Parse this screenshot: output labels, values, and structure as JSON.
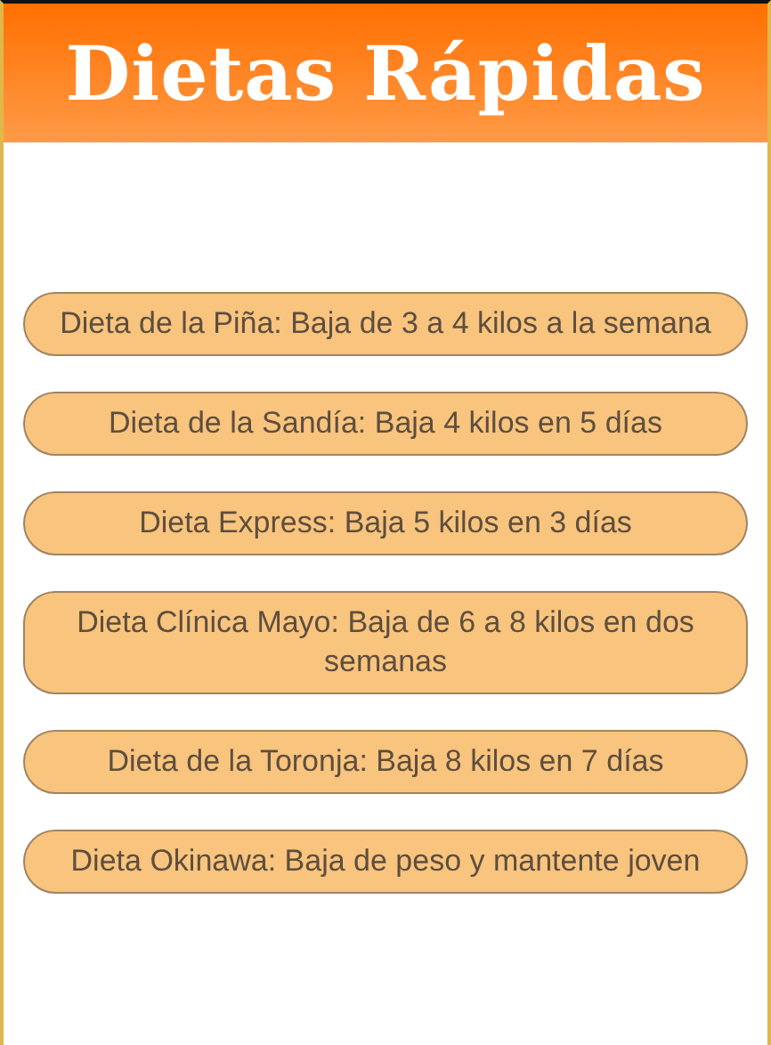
{
  "header": {
    "title": "Dietas Rápidas"
  },
  "diets": [
    {
      "label": "Dieta de la Piña: Baja de 3 a 4 kilos a la semana"
    },
    {
      "label": "Dieta de la Sandía: Baja 4 kilos en 5 días"
    },
    {
      "label": "Dieta Express: Baja 5 kilos en 3 días"
    },
    {
      "label": "Dieta Clínica Mayo: Baja de 6 a 8 kilos en dos semanas"
    },
    {
      "label": "Dieta de la Toronja: Baja 8 kilos en 7 días"
    },
    {
      "label": "Dieta Okinawa: Baja de peso y mantente joven"
    }
  ]
}
